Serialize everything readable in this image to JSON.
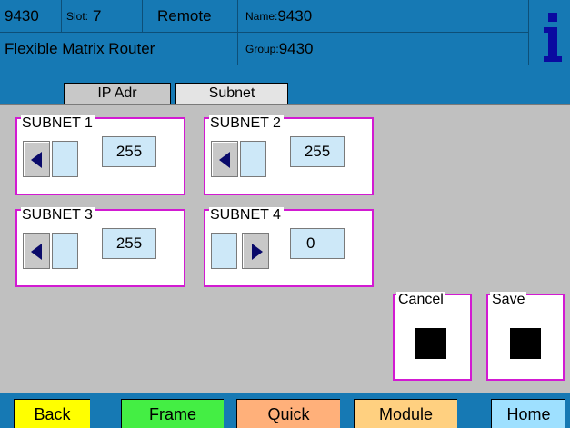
{
  "header": {
    "device_id": "9430",
    "slot_label": "Slot:",
    "slot_value": "7",
    "mode": "Remote",
    "name_label": "Name:",
    "name_value": "9430",
    "device_type": "Flexible Matrix Router",
    "group_label": "Group:",
    "group_value": "9430",
    "info_icon": "info-icon"
  },
  "tabs": [
    {
      "label": "IP Adr",
      "active": false
    },
    {
      "label": "Subnet",
      "active": true
    }
  ],
  "subnets": [
    {
      "label": "SUBNET 1",
      "value": "255",
      "arrow": "left"
    },
    {
      "label": "SUBNET 2",
      "value": "255",
      "arrow": "left"
    },
    {
      "label": "SUBNET 3",
      "value": "255",
      "arrow": "left"
    },
    {
      "label": "SUBNET 4",
      "value": "0",
      "arrow": "right"
    }
  ],
  "actions": {
    "cancel_label": "Cancel",
    "save_label": "Save"
  },
  "nav": [
    {
      "label": "Back",
      "color": "#ffff00"
    },
    {
      "label": "Frame",
      "color": "#44ee44"
    },
    {
      "label": "Quick",
      "color": "#ffb07a"
    },
    {
      "label": "Module",
      "color": "#ffd080"
    },
    {
      "label": "Home",
      "color": "#9ee0ff"
    }
  ],
  "colors": {
    "header_bg": "#1679b4",
    "panel_bg": "#c0c0c0",
    "group_border": "#d21ad2",
    "value_bg": "#cde8f8"
  }
}
